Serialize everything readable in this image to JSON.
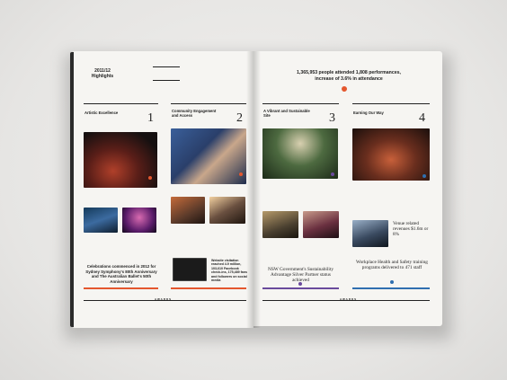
{
  "highlights": {
    "year": "2011/12",
    "label": "Highlights"
  },
  "stat": {
    "line1": "1,365,953 people attended 1,808 performances,",
    "line2": "increase of 3.6% in attendance"
  },
  "columns": [
    {
      "title": "Artistic Excellence",
      "number": "1"
    },
    {
      "title": "Community Engagement and Access",
      "number": "2"
    },
    {
      "title": "A Vibrant and Sustainable Site",
      "number": "3"
    },
    {
      "title": "Earning Our Way",
      "number": "4"
    }
  ],
  "callouts": {
    "celebrations": "Celebrations commenced in 2012 for Sydney Symphony's 80th Anniversary and The Australian Ballet's 50th Anniversary",
    "website": "Website visitation reached 4.9 million, 103,610 Facebook check-ins, 175,489 fans and followers on social media",
    "nsw": "NSW Government's Sustainability Advantage Silver Partner status achieved",
    "venue": "Venue related revenues $1.6m or 8%",
    "workplace": "Workplace Health and Safety training programs delivered to 471 staff"
  },
  "awards_label": "AWARDS",
  "colors": {
    "orange": "#e4572e",
    "purple": "#6a4a9c",
    "blue": "#2f6fb0",
    "green": "#4a9a4e",
    "dark": "#222222"
  }
}
